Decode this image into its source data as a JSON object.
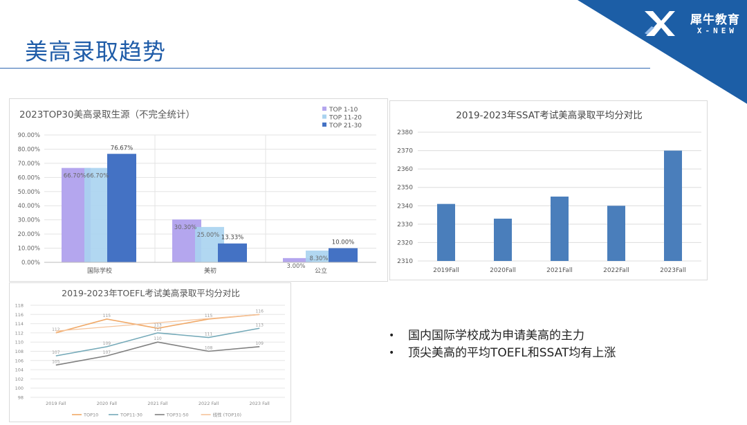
{
  "slide": {
    "title": "美高录取趋势",
    "brand_cn": "犀牛教育",
    "brand_en": "X-NEW",
    "bullets": [
      "国内国际学校成为申请美高的主力",
      "顶尖美高的平均TOEFL和SSAT均有上涨"
    ]
  },
  "colors": {
    "corner": "#1c5ea6",
    "title": "#1f5ca8",
    "bar": "#4a7ebb"
  },
  "chart_data": [
    {
      "type": "bar",
      "title": "2023TOP30美高录取生源（不完全统计）",
      "categories": [
        "国际学校",
        "美初",
        "公立"
      ],
      "series": [
        {
          "name": "TOP 1-10",
          "color": "#b4a6ee",
          "values": [
            66.7,
            30.3,
            3.0
          ],
          "labels": [
            "66.70%",
            "30.30%",
            "3.00%"
          ]
        },
        {
          "name": "TOP 11-20",
          "color": "#a9d3ef",
          "values": [
            66.7,
            25.0,
            8.3
          ],
          "labels": [
            "66.70%",
            "25.00%",
            "8.30%"
          ]
        },
        {
          "name": "TOP 21-30",
          "color": "#4472c4",
          "values": [
            76.67,
            13.33,
            10.0
          ],
          "labels": [
            "76.67%",
            "13.33%",
            "10.00%"
          ]
        }
      ],
      "ylim": [
        0,
        90
      ],
      "yticks": [
        "0.00%",
        "10.00%",
        "20.00%",
        "30.00%",
        "40.00%",
        "50.00%",
        "60.00%",
        "70.00%",
        "80.00%",
        "90.00%"
      ],
      "legend": "top-right",
      "grid": true
    },
    {
      "type": "bar",
      "title": "2019-2023年SSAT考试美高录取平均分对比",
      "categories": [
        "2019Fall",
        "2020Fall",
        "2021Fall",
        "2022Fall",
        "2023Fall"
      ],
      "values": [
        2341,
        2333,
        2345,
        2340,
        2370
      ],
      "ylim": [
        2310,
        2380
      ],
      "yticks": [
        "2310",
        "2320",
        "2330",
        "2340",
        "2350",
        "2360",
        "2370",
        "2380"
      ],
      "grid": true
    },
    {
      "type": "line",
      "title": "2019-2023年TOEFL考试美高录取平均分对比",
      "categories": [
        "2019 Fall",
        "2020 Fall",
        "2021 Fall",
        "2022 Fall",
        "2023 Fall"
      ],
      "series": [
        {
          "name": "TOP10",
          "color": "#f0a866",
          "values": [
            112,
            115,
            113,
            115,
            116
          ],
          "labels": [
            "112",
            "115",
            "113",
            "115",
            "116"
          ]
        },
        {
          "name": "TOP11-30",
          "color": "#74a9b8",
          "values": [
            107,
            109,
            112,
            111,
            113
          ],
          "labels": [
            "107",
            "109",
            "112",
            "111",
            "113"
          ]
        },
        {
          "name": "TOP31-50",
          "color": "#7f7f7f",
          "values": [
            105,
            107,
            110,
            108,
            109
          ],
          "labels": [
            "105",
            "107",
            "110",
            "108",
            "109"
          ]
        },
        {
          "name": "线性 (TOP10)",
          "color": "#f5c39a",
          "values": [
            112.4,
            113.3,
            114.2,
            115.1,
            116.0
          ],
          "labels": []
        }
      ],
      "ylim": [
        98,
        118
      ],
      "yticks": [
        "98",
        "100",
        "102",
        "104",
        "106",
        "108",
        "110",
        "112",
        "114",
        "116",
        "118"
      ],
      "legend": "bottom",
      "grid": true
    }
  ]
}
